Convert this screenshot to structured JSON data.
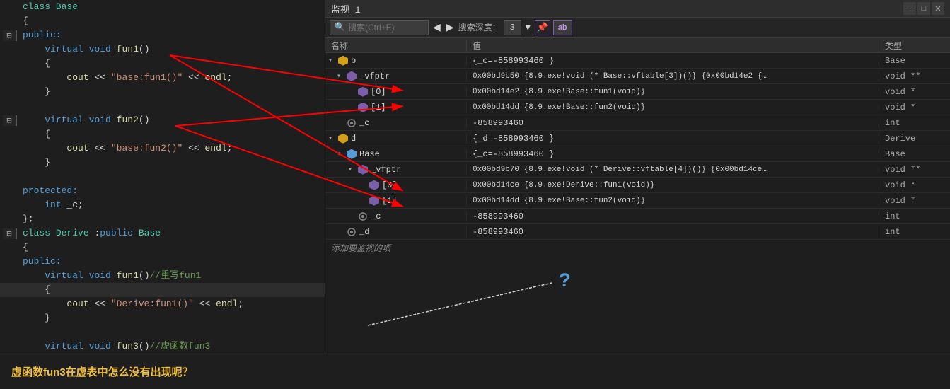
{
  "watch_panel": {
    "title": "监视 1",
    "search_placeholder": "搜索(Ctrl+E)",
    "depth_label": "搜索深度：",
    "depth_value": "3",
    "columns": {
      "name": "名称",
      "value": "值",
      "type": "类型"
    },
    "rows": [
      {
        "id": "b",
        "indent": 0,
        "expandable": true,
        "expanded": true,
        "icon": "cube-orange",
        "name": "b",
        "value": "{_c=-858993460 }",
        "type": "Base"
      },
      {
        "id": "b_vfptr",
        "indent": 1,
        "expandable": true,
        "expanded": true,
        "icon": "cube-purple",
        "name": "▸ _vfptr",
        "value": "0x00bd9b50 {8.9.exe!void (* Base::vftable[3])()} {0x00bd14e2 {…",
        "type": "void **"
      },
      {
        "id": "b_vfptr_0",
        "indent": 2,
        "expandable": false,
        "icon": "cube-purple",
        "name": "[0]",
        "value": "0x00bd14e2 {8.9.exe!Base::fun1(void)}",
        "type": "void *"
      },
      {
        "id": "b_vfptr_1",
        "indent": 2,
        "expandable": false,
        "icon": "cube-purple",
        "name": "[1]",
        "value": "0x00bd14dd {8.9.exe!Base::fun2(void)}",
        "type": "void *"
      },
      {
        "id": "b_c",
        "indent": 1,
        "expandable": false,
        "icon": "settings",
        "name": "_c",
        "value": "-858993460",
        "type": "int"
      },
      {
        "id": "d",
        "indent": 0,
        "expandable": true,
        "expanded": true,
        "icon": "cube-orange",
        "name": "d",
        "value": "{_d=-858993460 }",
        "type": "Derive"
      },
      {
        "id": "d_base",
        "indent": 1,
        "expandable": true,
        "expanded": true,
        "icon": "cube-blue",
        "name": "▸ Base",
        "value": "{_c=-858993460 }",
        "type": "Base"
      },
      {
        "id": "d_base_vfptr",
        "indent": 2,
        "expandable": true,
        "expanded": true,
        "icon": "cube-purple",
        "name": "▸ _vfptr",
        "value": "0x00bd9b70 {8.9.exe!void (* Derive::vftable[4])()} {0x00bd14ce…",
        "type": "void **"
      },
      {
        "id": "d_base_vfptr_0",
        "indent": 3,
        "expandable": false,
        "icon": "cube-purple",
        "name": "[0]",
        "value": "0x00bd14ce {8.9.exe!Derive::fun1(void)}",
        "type": "void *"
      },
      {
        "id": "d_base_vfptr_1",
        "indent": 3,
        "expandable": false,
        "icon": "cube-purple",
        "name": "[1]",
        "value": "0x00bd14dd {8.9.exe!Base::fun2(void)}",
        "type": "void *"
      },
      {
        "id": "d_base_c",
        "indent": 2,
        "expandable": false,
        "icon": "settings",
        "name": "_c",
        "value": "-858993460",
        "type": "int"
      },
      {
        "id": "d_d",
        "indent": 1,
        "expandable": false,
        "icon": "settings",
        "name": "_d",
        "value": "-858993460",
        "type": "int"
      }
    ],
    "add_watch_label": "添加要监视的项"
  },
  "code": {
    "lines": [
      {
        "num": "",
        "gutter": "",
        "text": "class Base",
        "classes": "kw-class"
      },
      {
        "num": "",
        "gutter": "",
        "text": "{",
        "classes": ""
      },
      {
        "num": "",
        "gutter": "minus",
        "text": "public:",
        "classes": "kw-blue"
      },
      {
        "num": "",
        "gutter": "",
        "text": "    virtual void fun1()",
        "classes": ""
      },
      {
        "num": "",
        "gutter": "",
        "text": "    {",
        "classes": ""
      },
      {
        "num": "",
        "gutter": "",
        "text": "        cout << \"base:fun1()\" << endl;",
        "classes": ""
      },
      {
        "num": "",
        "gutter": "",
        "text": "    }",
        "classes": ""
      },
      {
        "num": "",
        "gutter": "",
        "text": "",
        "classes": ""
      },
      {
        "num": "",
        "gutter": "minus",
        "text": "    virtual void fun2()",
        "classes": ""
      },
      {
        "num": "",
        "gutter": "",
        "text": "    {",
        "classes": ""
      },
      {
        "num": "",
        "gutter": "",
        "text": "        cout << \"base:fun2()\" << endl;",
        "classes": ""
      },
      {
        "num": "",
        "gutter": "",
        "text": "    }",
        "classes": ""
      },
      {
        "num": "",
        "gutter": "",
        "text": "",
        "classes": ""
      },
      {
        "num": "",
        "gutter": "",
        "text": "protected:",
        "classes": "kw-blue"
      },
      {
        "num": "",
        "gutter": "",
        "text": "    int _c;",
        "classes": ""
      },
      {
        "num": "",
        "gutter": "",
        "text": "};",
        "classes": ""
      },
      {
        "num": "",
        "gutter": "minus",
        "text": "class Derive :public Base",
        "classes": ""
      },
      {
        "num": "",
        "gutter": "",
        "text": "{",
        "classes": ""
      },
      {
        "num": "",
        "gutter": "",
        "text": "public:",
        "classes": "kw-blue"
      },
      {
        "num": "",
        "gutter": "",
        "text": "    virtual void fun1()//重写fun1",
        "classes": ""
      },
      {
        "num": "",
        "gutter": "",
        "text": "    {",
        "classes": "highlight-bg"
      },
      {
        "num": "",
        "gutter": "",
        "text": "        cout << \"Derive:fun1()\" << endl;",
        "classes": ""
      },
      {
        "num": "",
        "gutter": "",
        "text": "    }",
        "classes": ""
      },
      {
        "num": "",
        "gutter": "",
        "text": "",
        "classes": ""
      },
      {
        "num": "",
        "gutter": "",
        "text": "    virtual void fun3()//虚函数fun3",
        "classes": ""
      }
    ]
  },
  "bottom_question": "虚函数fun3在虚表中怎么没有出现呢？",
  "question_mark": "?",
  "title_controls": [
    "─",
    "□",
    "✕"
  ]
}
